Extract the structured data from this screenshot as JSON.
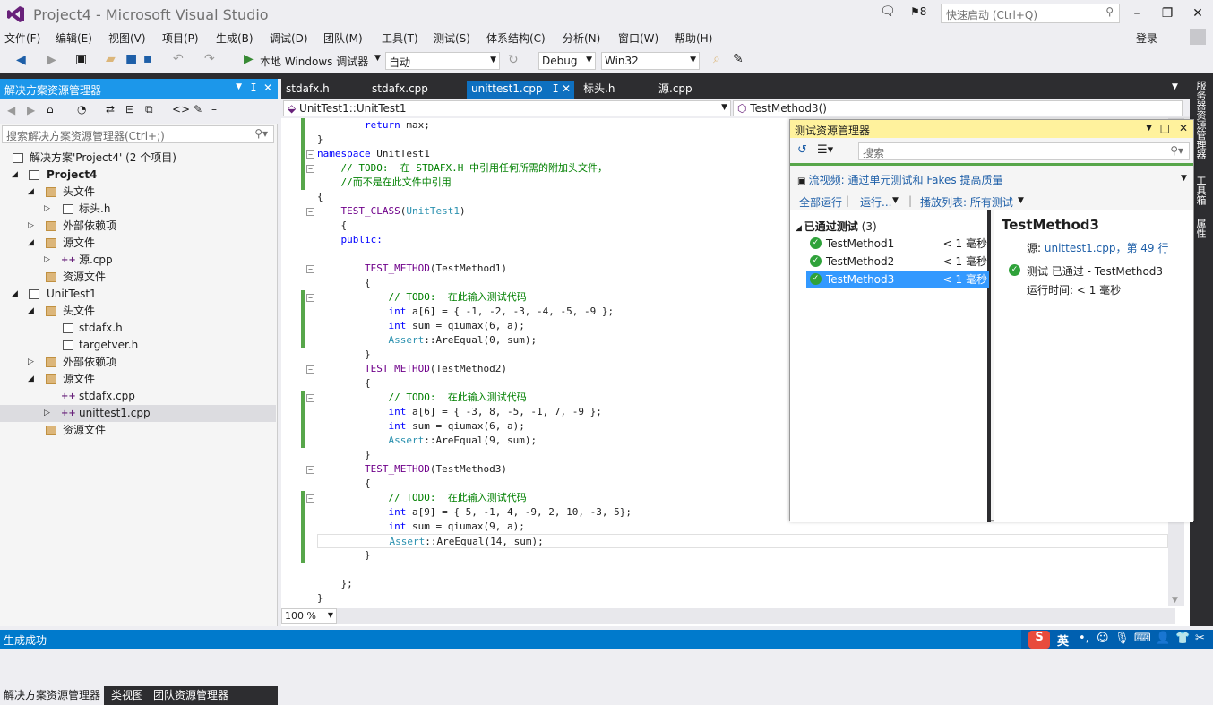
{
  "title": "Project4 - Microsoft Visual Studio",
  "notifications": "8",
  "quick_launch": "快速启动 (Ctrl+Q)",
  "login": "登录",
  "menu": [
    "文件(F)",
    "编辑(E)",
    "视图(V)",
    "项目(P)",
    "生成(B)",
    "调试(D)",
    "团队(M)",
    "工具(T)",
    "测试(S)",
    "体系结构(C)",
    "分析(N)",
    "窗口(W)",
    "帮助(H)"
  ],
  "toolbar": {
    "run_label": "本地 Windows 调试器",
    "auto": "自动",
    "config": "Debug",
    "platform": "Win32"
  },
  "solution": {
    "header": "解决方案资源管理器",
    "search": "搜索解决方案资源管理器(Ctrl+;)",
    "tree": [
      "解决方案'Project4' (2 个项目)",
      "Project4",
      "头文件",
      "标头.h",
      "外部依赖项",
      "源文件",
      "源.cpp",
      "资源文件",
      "UnitTest1",
      "头文件",
      "stdafx.h",
      "targetver.h",
      "外部依赖项",
      "源文件",
      "stdafx.cpp",
      "unittest1.cpp",
      "资源文件"
    ],
    "bottom_tabs": [
      "解决方案资源管理器",
      "类视图",
      "团队资源管理器"
    ]
  },
  "editor": {
    "tabs": [
      "stdafx.h",
      "stdafx.cpp",
      "unittest1.cpp",
      "标头.h",
      "源.cpp"
    ],
    "nav_left": "UnitTest1::UnitTest1",
    "nav_right": "TestMethod3()",
    "zoom": "100 %",
    "code": [
      "        return max;",
      "}",
      "namespace UnitTest1",
      "    // TODO:  在 STDAFX.H 中引用任何所需的附加头文件，",
      "    //而不是在此文件中引用",
      "{",
      "    TEST_CLASS(UnitTest1)",
      "    {",
      "    public:",
      "",
      "        TEST_METHOD(TestMethod1)",
      "        {",
      "            // TODO:  在此输入测试代码",
      "            int a[6] = { -1, -2, -3, -4, -5, -9 };",
      "            int sum = qiumax(6, a);",
      "            Assert::AreEqual(0, sum);",
      "        }",
      "        TEST_METHOD(TestMethod2)",
      "        {",
      "            // TODO:  在此输入测试代码",
      "            int a[6] = { -3, 8, -5, -1, 7, -9 };",
      "            int sum = qiumax(6, a);",
      "            Assert::AreEqual(9, sum);",
      "        }",
      "        TEST_METHOD(TestMethod3)",
      "        {",
      "            // TODO:  在此输入测试代码",
      "            int a[9] = { 5, -1, 4, -9, 2, 10, -3, 5};",
      "            int sum = qiumax(9, a);",
      "            Assert::AreEqual(14, sum);",
      "        }",
      "",
      "    };",
      "}"
    ]
  },
  "right_strip": [
    "服务器资源管理器",
    "工具箱",
    "属性"
  ],
  "test_explorer": {
    "header": "测试资源管理器",
    "search": "搜索",
    "video_link": "流视频: 通过单元测试和 Fakes 提高质量",
    "run_all": "全部运行",
    "run": "运行...",
    "playlist": "播放列表: 所有测试",
    "group": "已通过测试",
    "group_count": "(3)",
    "tests": [
      {
        "name": "TestMethod1",
        "time": "< 1 毫秒"
      },
      {
        "name": "TestMethod2",
        "time": "< 1 毫秒"
      },
      {
        "name": "TestMethod3",
        "time": "< 1 毫秒"
      }
    ],
    "detail": {
      "title": "TestMethod3",
      "source_label": "源:",
      "source_link": "unittest1.cpp，第 49 行",
      "result": "测试 已通过 - TestMethod3",
      "runtime": "运行时间: < 1 毫秒"
    }
  },
  "status": "生成成功",
  "tray": {
    "ime": "英"
  }
}
